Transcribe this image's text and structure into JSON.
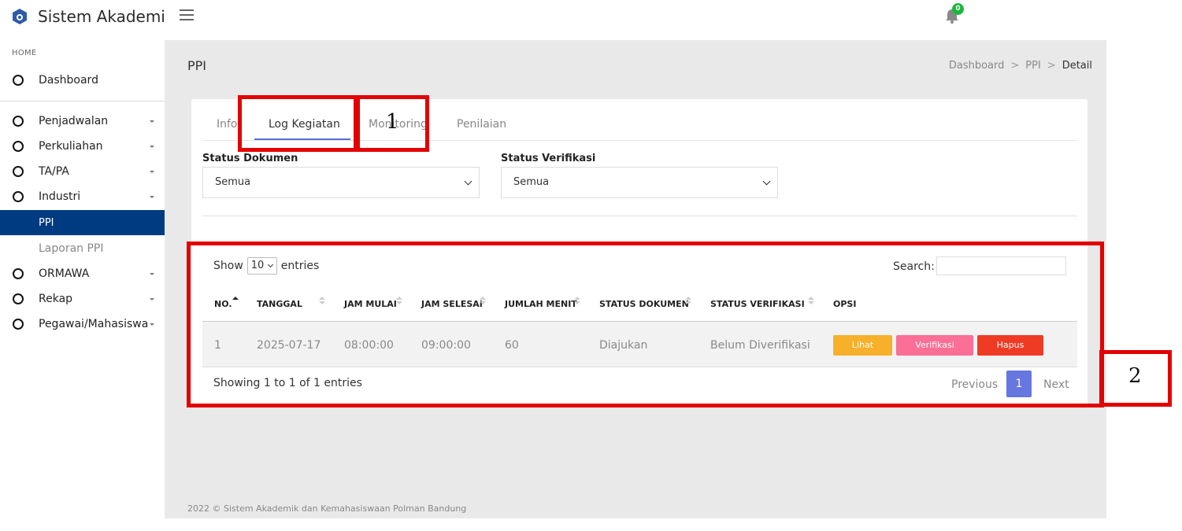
{
  "app": {
    "title": "Sistem Akademik",
    "notification_count": "0"
  },
  "sidebar": {
    "section_label": "HOME",
    "items": [
      {
        "label": "Dashboard"
      },
      {
        "label": "Penjadwalan"
      },
      {
        "label": "Perkuliahan"
      },
      {
        "label": "TA/PA"
      },
      {
        "label": "Industri"
      },
      {
        "label": "PPI"
      },
      {
        "label": "Laporan PPI"
      },
      {
        "label": "ORMAWA"
      },
      {
        "label": "Rekap"
      },
      {
        "label": "Pegawai/Mahasiswa"
      }
    ]
  },
  "page": {
    "title": "PPI",
    "breadcrumb": [
      "Dashboard",
      "PPI",
      "Detail"
    ],
    "separator": ">"
  },
  "tabs": [
    "Info",
    "Log Kegiatan",
    "Monitoring",
    "Penilaian"
  ],
  "active_tab": "Log Kegiatan",
  "filters": {
    "status_dokumen": {
      "label": "Status Dokumen",
      "value": "Semua"
    },
    "status_verifikasi": {
      "label": "Status Verifikasi",
      "value": "Semua"
    }
  },
  "table": {
    "show_label": "Show",
    "length_value": "10",
    "entries_label": "entries",
    "search_label": "Search:",
    "columns": [
      "NO.",
      "TANGGAL",
      "JAM MULAI",
      "JAM SELESAI",
      "JUMLAH MENIT",
      "STATUS DOKUMEN",
      "STATUS VERIFIKASI",
      "OPSI"
    ],
    "rows": [
      {
        "no": "1",
        "tanggal": "2025-07-17",
        "jam_mulai": "08:00:00",
        "jam_selesai": "09:00:00",
        "jumlah_menit": "60",
        "status_dokumen": "Diajukan",
        "status_verifikasi": "Belum Diverifikasi"
      }
    ],
    "actions": {
      "view": "Lihat",
      "verify": "Verifikasi",
      "delete": "Hapus"
    },
    "info": "Showing 1 to 1 of 1 entries",
    "pagination": {
      "previous": "Previous",
      "current": "1",
      "next": "Next"
    }
  },
  "footer": "2022 © Sistem Akademik dan Kemahasiswaan Polman Bandung",
  "annotations": [
    "1",
    "2"
  ],
  "colors": {
    "sidebar_active": "#003a80",
    "tab_underline": "#5a6fd8",
    "btn_view": "#f6b02a",
    "btn_verify": "#fb6e96",
    "btn_delete": "#f03b24",
    "page_current": "#6777e0",
    "annotation": "#e30000"
  }
}
